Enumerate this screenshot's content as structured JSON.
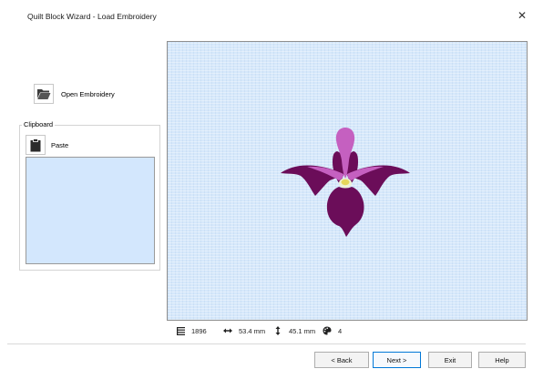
{
  "window": {
    "title": "Quilt Block Wizard - Load Embroidery",
    "close_glyph": "✕"
  },
  "left_panel": {
    "open_label": "Open Embroidery",
    "open_icon": "folder-open-icon",
    "clipboard": {
      "legend": "Clipboard",
      "paste_label": "Paste",
      "paste_icon": "clipboard-icon"
    }
  },
  "status": {
    "stitches": "1896",
    "width": "53.4 mm",
    "height": "45.1 mm",
    "colors": "4"
  },
  "buttons": {
    "back": "< Back",
    "next": "Next >",
    "exit": "Exit",
    "help": "Help"
  },
  "colors": {
    "canvas_bg": "#d6e8fb",
    "petal_dark": "#6b0d59",
    "petal_light": "#c560c0",
    "accent": "#0078d7"
  }
}
